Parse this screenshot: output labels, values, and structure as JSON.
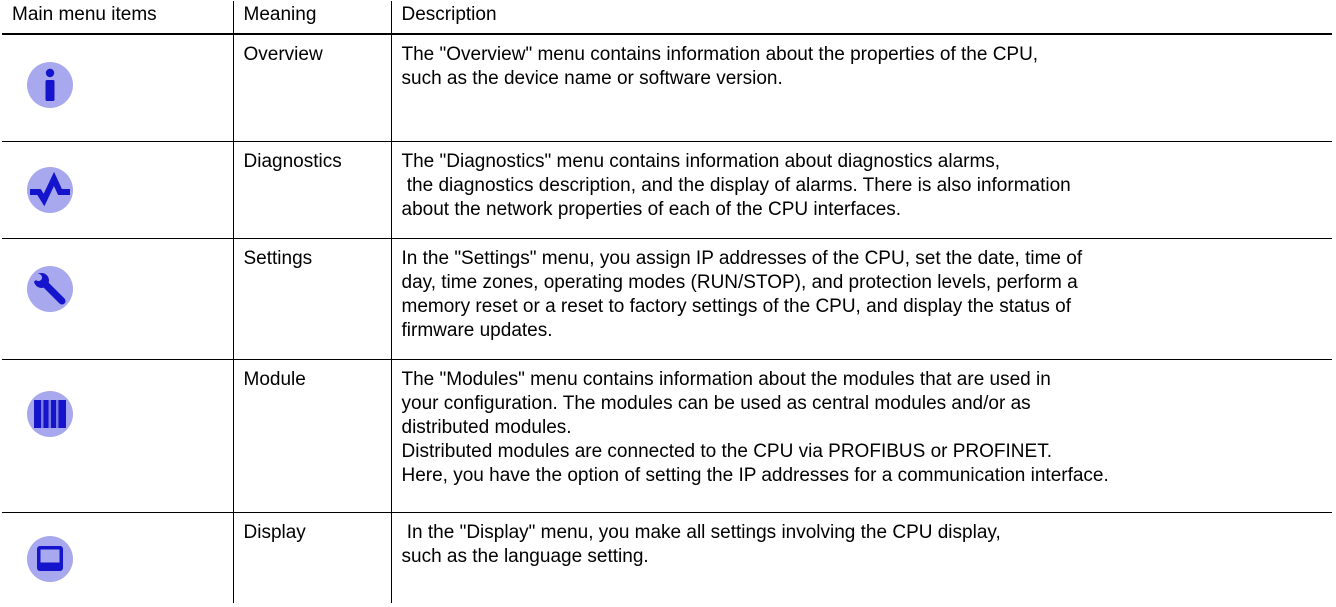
{
  "headers": {
    "main_menu_items": "Main menu items",
    "meaning": "Meaning",
    "description": "Description"
  },
  "rows": [
    {
      "icon": "info-icon",
      "meaning": "Overview",
      "description": [
        "The \"Overview\" menu contains information about the properties of the CPU,",
        "such as the device name or software version."
      ]
    },
    {
      "icon": "diagnostics-icon",
      "meaning": "Diagnostics",
      "description": [
        "The \"Diagnostics\" menu contains information about diagnostics alarms,",
        " the diagnostics description, and the display of alarms. There is also information",
        "about the network properties of each of the CPU interfaces."
      ]
    },
    {
      "icon": "wrench-icon",
      "meaning": "Settings",
      "description": [
        "In the \"Settings\" menu, you assign IP addresses of the CPU, set the date, time of",
        "day, time zones, operating modes (RUN/STOP), and protection levels, perform a",
        "memory reset or a reset to factory settings of the CPU, and display the status of",
        "firmware updates."
      ]
    },
    {
      "icon": "module-icon",
      "meaning": "Module",
      "description": [
        "The \"Modules\" menu contains information about the modules that are used in",
        "your configuration. The modules can be used as central modules and/or as",
        "distributed modules.",
        "Distributed modules are connected to the CPU via PROFIBUS or PROFINET.",
        "Here, you have the option of setting the IP addresses for a communication interface."
      ]
    },
    {
      "icon": "display-icon",
      "meaning": "Display",
      "description": [
        " In the \"Display\" menu, you make all settings involving the CPU display,",
        "such as the language setting."
      ]
    }
  ],
  "colors": {
    "icon_circle": "#a8a8ee",
    "icon_glyph": "#1414cc"
  }
}
